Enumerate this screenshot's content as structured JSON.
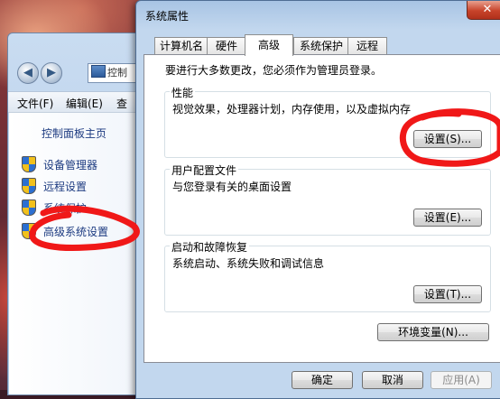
{
  "colors": {
    "annotation_red": "#f01818",
    "link_blue": "#1c3a80",
    "dialog_frame": "#c2d7ee"
  },
  "control_panel": {
    "address": "控制",
    "menu": [
      "文件(F)",
      "编辑(E)",
      "查"
    ],
    "home_link": "控制面板主页",
    "links": [
      {
        "label": "设备管理器",
        "icon": "uac-shield-icon"
      },
      {
        "label": "远程设置",
        "icon": "uac-shield-icon"
      },
      {
        "label": "系统保护",
        "icon": "uac-shield-icon"
      },
      {
        "label": "高级系统设置",
        "icon": "uac-shield-icon"
      }
    ]
  },
  "dialog": {
    "title": "系统属性",
    "close_label": "✕",
    "tabs": [
      "计算机名",
      "硬件",
      "高级",
      "系统保护",
      "远程"
    ],
    "active_tab": "高级",
    "admin_note": "要进行大多数更改，您必须作为管理员登录。",
    "groups": {
      "performance": {
        "title": "性能",
        "description": "视觉效果，处理器计划，内存使用，以及虚拟内存",
        "button": "设置(S)..."
      },
      "user_profiles": {
        "title": "用户配置文件",
        "description": "与您登录有关的桌面设置",
        "button": "设置(E)..."
      },
      "startup_recovery": {
        "title": "启动和故障恢复",
        "description": "系统启动、系统失败和调试信息",
        "button": "设置(T)..."
      }
    },
    "env_button": "环境变量(N)...",
    "footer": {
      "ok": "确定",
      "cancel": "取消",
      "apply": "应用(A)"
    }
  }
}
